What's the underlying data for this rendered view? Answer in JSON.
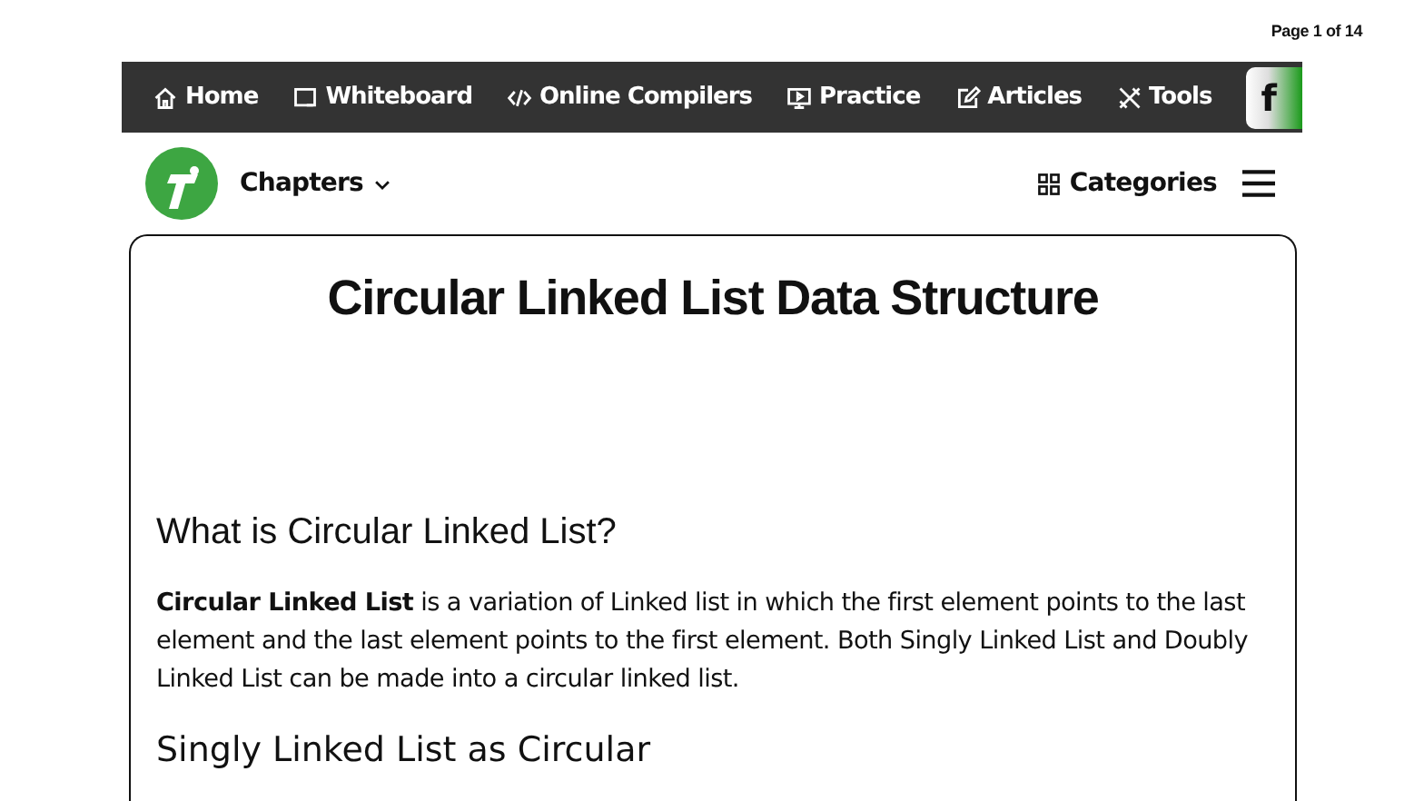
{
  "page_label": "Page 1 of 14",
  "nav": [
    {
      "label": "Home"
    },
    {
      "label": "Whiteboard"
    },
    {
      "label": "Online Compilers"
    },
    {
      "label": "Practice"
    },
    {
      "label": "Articles"
    },
    {
      "label": "Tools"
    }
  ],
  "social": "f",
  "header": {
    "chapters": "Chapters",
    "categories": "Categories"
  },
  "article": {
    "title": "Circular Linked List Data Structure",
    "heading": "What is Circular Linked List?",
    "paragraph": "**Circular Linked List** is a variation of Linked list in which the first element points to the last element and the last element points to the first element. Both Singly Linked List and Doubly Linked List can be made into a circular linked list.",
    "subheading": "Singly Linked List as Circular"
  }
}
